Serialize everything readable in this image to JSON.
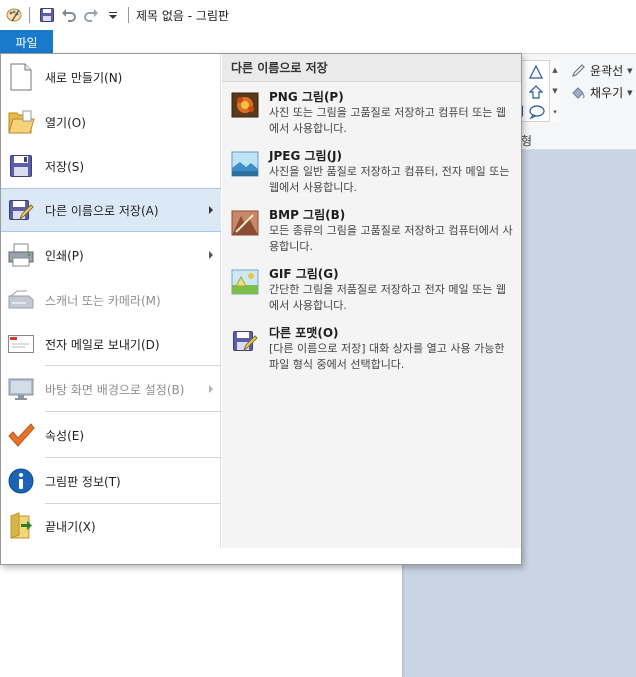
{
  "window": {
    "title": "제목 없음 - 그림판"
  },
  "quick_access": {
    "icons": [
      "paint-app-icon",
      "save-icon",
      "undo-icon",
      "redo-icon",
      "customize-dropdown-icon"
    ]
  },
  "ribbon": {
    "file_tab": "파일",
    "outline_label": "윤곽선",
    "fill_label": "채우기",
    "shapes_group_label": "형"
  },
  "file_menu": {
    "left_items": [
      {
        "label": "새로 만들기(N)",
        "icon": "new-file-icon",
        "enabled": true,
        "submenu": false
      },
      {
        "label": "열기(O)",
        "icon": "open-folder-icon",
        "enabled": true,
        "submenu": false
      },
      {
        "label": "저장(S)",
        "icon": "save-icon",
        "enabled": true,
        "submenu": false
      },
      {
        "label": "다른 이름으로 저장(A)",
        "icon": "save-as-icon",
        "enabled": true,
        "submenu": true,
        "active": true
      },
      {
        "label": "인쇄(P)",
        "icon": "printer-icon",
        "enabled": true,
        "submenu": true
      },
      {
        "label": "스캐너 또는 카메라(M)",
        "icon": "scanner-icon",
        "enabled": false,
        "submenu": false
      },
      {
        "label": "전자 메일로 보내기(D)",
        "icon": "email-icon",
        "enabled": true,
        "submenu": false
      },
      {
        "label": "바탕 화면 배경으로 설정(B)",
        "icon": "desktop-background-icon",
        "enabled": false,
        "submenu": true
      },
      {
        "label": "속성(E)",
        "icon": "checkmark-icon",
        "enabled": true,
        "submenu": false
      },
      {
        "label": "그림판 정보(T)",
        "icon": "info-icon",
        "enabled": true,
        "submenu": false
      },
      {
        "label": "끝내기(X)",
        "icon": "exit-icon",
        "enabled": true,
        "submenu": false
      }
    ],
    "save_as_panel": {
      "header": "다른 이름으로 저장",
      "items": [
        {
          "title": "PNG 그림(P)",
          "description": "사진 또는 그림을 고품질로 저장하고 컴퓨터 또는 웹에서 사용합니다.",
          "icon": "png-icon"
        },
        {
          "title": "JPEG 그림(J)",
          "description": "사진을 일반 품질로 저장하고 컴퓨터, 전자 메일 또는 웹에서 사용합니다.",
          "icon": "jpeg-icon"
        },
        {
          "title": "BMP 그림(B)",
          "description": "모든 종류의 그림을 고품질로 저장하고 컴퓨터에서 사용합니다.",
          "icon": "bmp-icon"
        },
        {
          "title": "GIF 그림(G)",
          "description": "간단한 그림을 저품질로 저장하고 전자 메일 또는 웹에서 사용합니다.",
          "icon": "gif-icon"
        },
        {
          "title": "다른 포맷(O)",
          "description": "[다른 이름으로 저장] 대화 상자를 열고 사용 가능한 파일 형식 중에서 선택합니다.",
          "icon": "other-formats-icon"
        }
      ]
    }
  },
  "colors": {
    "file_tab": "#1979ca",
    "menu_highlight": "#dbe9f7",
    "workspace": "#c9d4e4",
    "checkmark": "#e8742b",
    "info": "#1c63b7"
  }
}
